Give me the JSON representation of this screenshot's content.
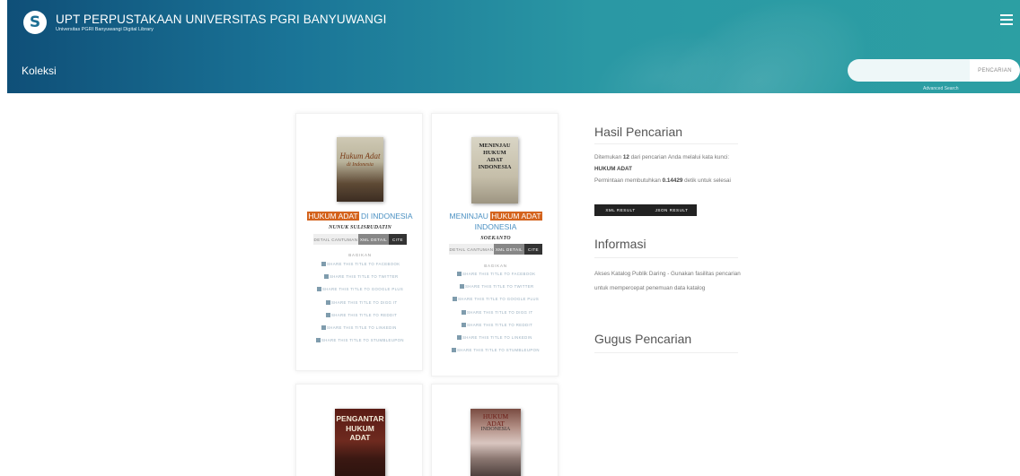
{
  "header": {
    "logo_glyph": "S",
    "title": "UPT PERPUSTAKAAN UNIVERSITAS PGRI BANYUWANGI",
    "subtitle": "Universitas PGRI Banyuwangi Digital Library",
    "page_title": "Koleksi",
    "search": {
      "value": "",
      "button_label": "PENCARIAN"
    },
    "advanced_search": "Advanced Search",
    "menu_icon": "hamburger-menu-icon"
  },
  "books": [
    {
      "cover_text": [
        "Hukum Adat",
        "di Indonesia"
      ],
      "title_parts": [
        {
          "text": "HUKUM",
          "hl": true
        },
        {
          "text": "ADAT",
          "hl": true
        },
        {
          "text": " DI INDONESIA",
          "hl": false
        }
      ],
      "author": "NUNUK SULISRUDATIN",
      "buttons": [
        "DETAIL CANTUMAN",
        "XML DETAIL",
        "CITE"
      ],
      "share_heading": "BAGIKAN",
      "share": [
        "SHARE THIS TITLE TO FACEBOOK",
        "SHARE THIS TITLE TO TWITTER",
        "SHARE THIS TITLE TO GOOGLE PLUS",
        "SHARE THIS TITLE TO DIGG IT",
        "SHARE THIS TITLE TO REDDIT",
        "SHARE THIS TITLE TO LINKEDIN",
        "SHARE THIS TITLE TO STUMBLEUPON"
      ]
    },
    {
      "cover_text": [
        "MENINJAU",
        "HUKUM",
        "ADAT",
        "INDONESIA"
      ],
      "title_parts": [
        {
          "text": "MENINJAU ",
          "hl": false
        },
        {
          "text": "HUKUM",
          "hl": true
        },
        {
          "text": "ADAT",
          "hl": true
        }
      ],
      "title_line2": "INDONESIA",
      "author": "SOEKANTO",
      "buttons": [
        "DETAIL CANTUMAN",
        "XML DETAIL",
        "CITE"
      ],
      "share_heading": "BAGIKAN",
      "share": [
        "SHARE THIS TITLE TO FACEBOOK",
        "SHARE THIS TITLE TO TWITTER",
        "SHARE THIS TITLE TO GOOGLE PLUS",
        "SHARE THIS TITLE TO DIGG IT",
        "SHARE THIS TITLE TO REDDIT",
        "SHARE THIS TITLE TO LINKEDIN",
        "SHARE THIS TITLE TO STUMBLEUPON"
      ]
    },
    {
      "cover_text": [
        "PENGANTAR",
        "HUKUM ADAT"
      ]
    },
    {
      "cover_text": [
        "HUKUM",
        "ADAT",
        "INDONESIA"
      ]
    }
  ],
  "sidebar": {
    "results_heading": "Hasil Pencarian",
    "results_1": "Ditemukan ",
    "results_count": "12",
    "results_2": " dari pencarian Anda melalui kata kunci: ",
    "results_keyword": "HUKUM ADAT",
    "timing_1": "Permintaan membutuhkan ",
    "timing_value": "0.14429",
    "timing_2": " detik untuk selesai",
    "xml_result": "XML RESULT",
    "json_result": "JSON RESULT",
    "info_heading": "Informasi",
    "info_text": "Akses Katalog Publik Daring - Gunakan fasilitas pencarian untuk mempercepat penemuan data katalog",
    "cluster_heading": "Gugus Pencarian"
  },
  "colors": {
    "header_start": "#0f4f78",
    "header_end": "#2c9fa3",
    "highlight": "#d4631d",
    "title_link": "#4a90c2"
  }
}
